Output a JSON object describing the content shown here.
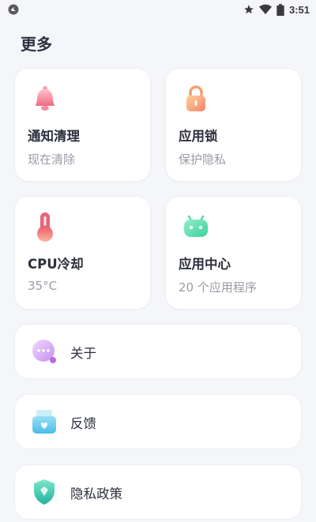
{
  "status_bar": {
    "time": "3:51",
    "left_icon": "app-notification-icon",
    "icons": [
      "star-icon",
      "wifi-icon",
      "battery-icon"
    ]
  },
  "page": {
    "title": "更多"
  },
  "cards": [
    {
      "id": "notification-clean",
      "title": "通知清理",
      "subtitle": "现在清除",
      "icon": "bell-icon"
    },
    {
      "id": "app-lock",
      "title": "应用锁",
      "subtitle": "保护隐私",
      "icon": "lock-icon"
    },
    {
      "id": "cpu-cool",
      "title": "CPU冷却",
      "subtitle": "35°C",
      "icon": "thermometer-icon"
    },
    {
      "id": "app-center",
      "title": "应用中心",
      "subtitle": "20 个应用程序",
      "icon": "android-icon"
    }
  ],
  "rows": [
    {
      "id": "about",
      "label": "关于",
      "icon": "chat-bubble-icon"
    },
    {
      "id": "feedback",
      "label": "反馈",
      "icon": "mail-heart-icon"
    },
    {
      "id": "privacy",
      "label": "隐私政策",
      "icon": "shield-icon"
    }
  ],
  "colors": {
    "background": "#f5f6fa",
    "card": "#ffffff",
    "title_text": "#2c2f3d",
    "sub_text": "#9a9ca6"
  }
}
